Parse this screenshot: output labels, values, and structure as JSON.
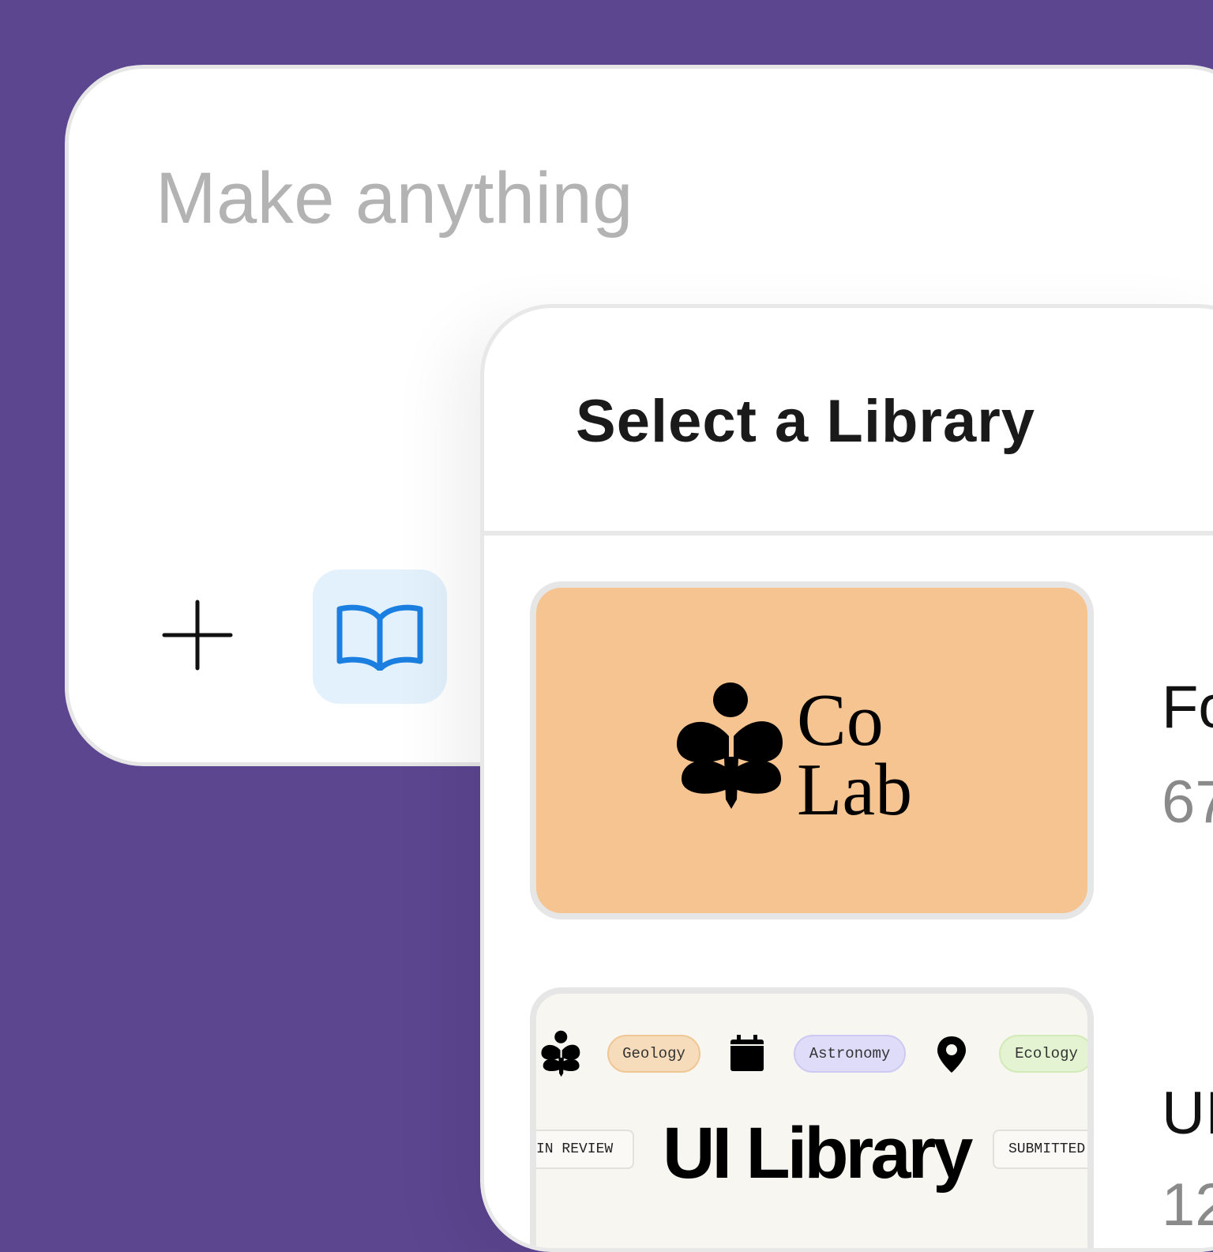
{
  "prompt": {
    "placeholder": "Make anything",
    "add_icon": "plus-icon",
    "library_icon": "book-open-icon",
    "library_button_bg": "#e3f1fc",
    "library_icon_color": "#1a7fe0"
  },
  "library_panel": {
    "title": "Select a Library",
    "items": [
      {
        "thumbnail_logo": "CoLab",
        "thumbnail_logo_line1": "Co",
        "thumbnail_logo_line2": "Lab",
        "thumbnail_bg": "#f5c490",
        "name": "Fo",
        "count": "67"
      },
      {
        "thumbnail_title": "UI Library",
        "tags": [
          "Geology",
          "Astronomy",
          "Ecology"
        ],
        "statuses": [
          "IN REVIEW",
          "SUBMITTED"
        ],
        "icons": [
          "sprout-icon",
          "calendar-icon",
          "map-pin-icon"
        ],
        "name": "UI",
        "count": "12"
      }
    ]
  },
  "colors": {
    "background": "#5c4690",
    "card": "#ffffff",
    "placeholder_text": "#b3b3b3"
  }
}
